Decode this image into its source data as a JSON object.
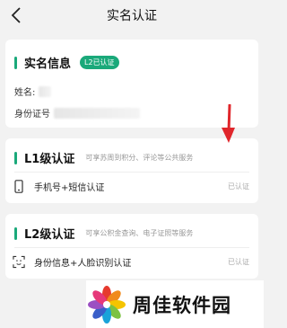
{
  "header": {
    "title": "实名认证",
    "back_icon": "chevron-left-icon"
  },
  "realname": {
    "title": "实名信息",
    "badge": "L2已认证",
    "name_label": "姓名:",
    "id_label": "身份证号"
  },
  "l1": {
    "title": "L1级认证",
    "desc": "可享苏周到积分、评论等公共服务",
    "method_icon": "phone-icon",
    "method": "手机号+短信认证",
    "status": "已认证"
  },
  "l2": {
    "title": "L2级认证",
    "desc": "可享公积金查询、电子证照等服务",
    "method_icon": "face-scan-icon",
    "method": "身份信息+人脸识别认证",
    "status": "已认证"
  },
  "watermark": {
    "text": "周佳软件园",
    "logo_icon": "pinwheel-logo-icon"
  },
  "colors": {
    "accent": "#1aa97a",
    "arrow": "#e0262b",
    "background": "#f2f2f2"
  }
}
